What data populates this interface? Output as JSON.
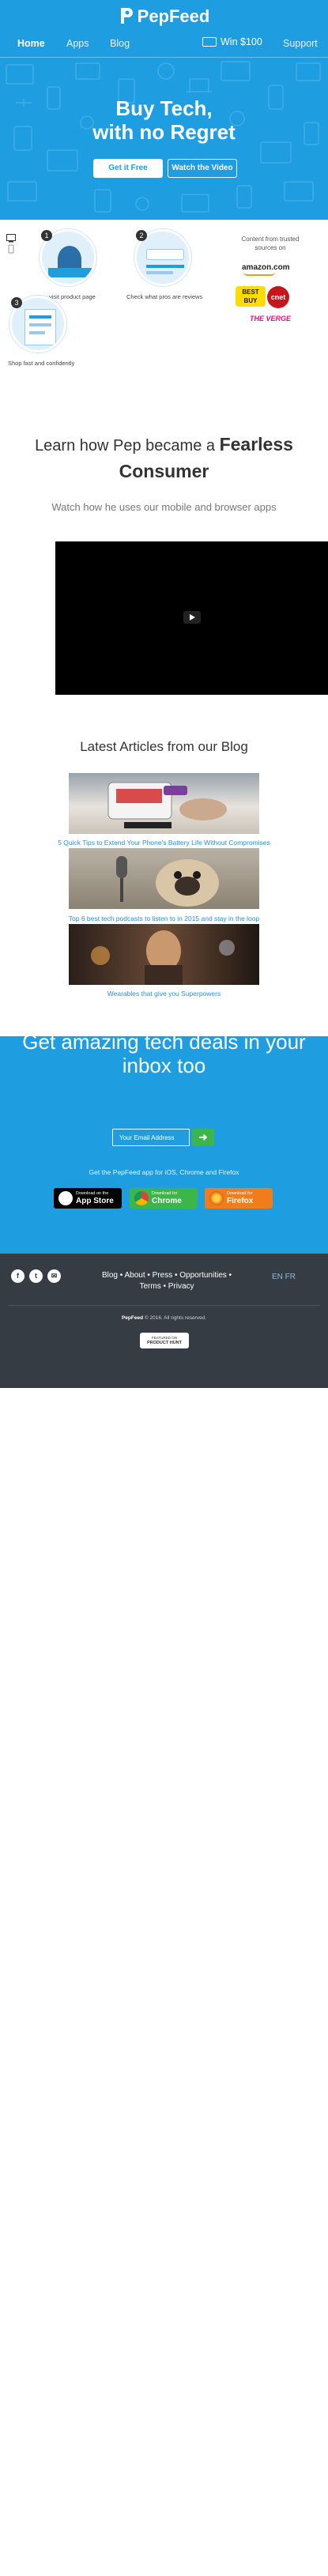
{
  "brand": {
    "name": "PepFeed"
  },
  "nav": {
    "items": [
      {
        "label": "Home",
        "active": true
      },
      {
        "label": "Apps",
        "active": false
      },
      {
        "label": "Blog",
        "active": false
      }
    ],
    "win_label": "Win $100",
    "support_label": "Support"
  },
  "hero": {
    "title_line1": "Buy Tech,",
    "title_line2": "with no Regret",
    "cta_primary": "Get it Free",
    "cta_secondary": "Watch the Video"
  },
  "features": {
    "steps": [
      {
        "number": "1",
        "text": "visit product page"
      },
      {
        "number": "2",
        "text": "Check what pros are reviews"
      },
      {
        "number": "3",
        "text": "Shop fast and confidently"
      }
    ],
    "content_from": "Content from trusted sources on",
    "sources": [
      "amazon.com",
      "BEST BUY",
      "cnet",
      "THE VERGE"
    ]
  },
  "learn": {
    "title_prefix": "Learn how Pep became a",
    "title_bold": "Fearless Consumer",
    "subtitle": "Watch how he uses our mobile and browser apps"
  },
  "blog": {
    "heading": "Latest Articles from our Blog",
    "articles": [
      {
        "caption": "5 Quick Tips to Extend Your Phone's Battery Life Without Compromises"
      },
      {
        "caption": "Top 6 best tech podcasts to listen to in 2015 and stay in the loop"
      },
      {
        "caption": "Wearables that give you Superpowers"
      }
    ]
  },
  "newsletter": {
    "title_line1": "Get amazing tech deals in your",
    "title_line2": "inbox too",
    "email_placeholder": "Your Email Address",
    "submit_arrow": "➜",
    "get_app_text": "Get the PepFeed app for iOS, Chrome and Firefox",
    "stores": [
      {
        "small": "Download on the",
        "big": "App Store",
        "color": "#000000"
      },
      {
        "small": "Download for",
        "big": "Chrome",
        "color": "#3cb54a"
      },
      {
        "small": "Download for",
        "big": "Firefox",
        "color": "#f07c1a"
      }
    ]
  },
  "footer": {
    "social": [
      "f",
      "t",
      "✉"
    ],
    "links_line1": "Blog • About • Press • Opportunities •",
    "links_line2": "Terms • Privacy",
    "languages": "EN   FR",
    "copyright_brand": "PepFeed",
    "copyright_rest": "© 2016. All rights reserved.",
    "badge_line1": "FEATURED ON",
    "badge_line2": "PRODUCT HUNT"
  },
  "colors": {
    "primary": "#1e9de0",
    "footer_bg": "#353c43",
    "accent_green": "#3cb54a",
    "link_blue": "#2a8fd6"
  }
}
